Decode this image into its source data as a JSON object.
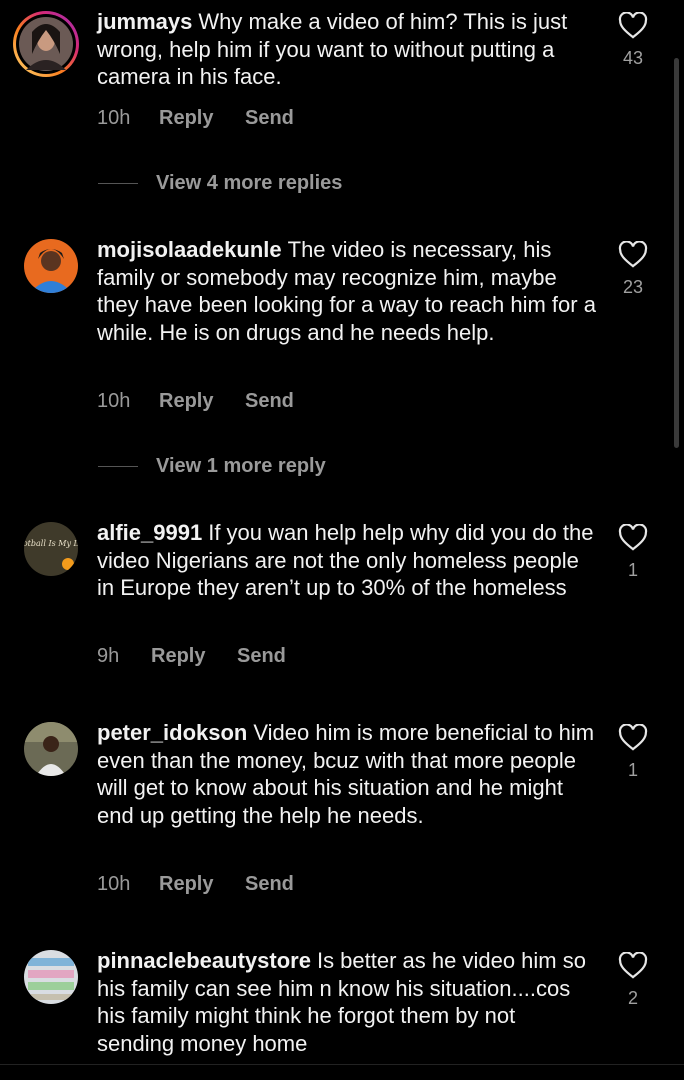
{
  "comments": [
    {
      "username": "jummays",
      "text": "Why make a video of him? This is just wrong, help him if you want to without putting a camera in his face.",
      "time": "10h",
      "reply_label": "Reply",
      "send_label": "Send",
      "likes": "43",
      "more_replies": "View 4 more replies"
    },
    {
      "username": "mojisolaadekunle",
      "text": "The video is necessary, his family or somebody may recognize him, maybe they have been looking for a way to reach him for a while.  He is on drugs and he needs help.",
      "time": "10h",
      "reply_label": "Reply",
      "send_label": "Send",
      "likes": "23",
      "more_replies": "View 1 more reply"
    },
    {
      "username": "alfie_9991",
      "text": "If you wan help help why did you do the video Nigerians are not the only homeless people in Europe they aren’t up to 30% of the homeless",
      "time": "9h",
      "reply_label": "Reply",
      "send_label": "Send",
      "likes": "1",
      "avatar_text": "Football Is My Life"
    },
    {
      "username": "peter_idokson",
      "text": "Video him is more beneficial to him even than the money, bcuz with that more people will get to know about his situation and he might end  up getting the help he needs.",
      "time": "10h",
      "reply_label": "Reply",
      "send_label": "Send",
      "likes": "1"
    },
    {
      "username": "pinnaclebeautystore",
      "text": "Is better as he video him so his family can see him n know his situation....cos his family might think he forgot them by not sending money home",
      "likes": "2"
    }
  ],
  "icons": {
    "like": "heart-outline-icon"
  },
  "colors": {
    "background": "#000000",
    "text": "#f2f2f2",
    "muted": "#9a9a9a",
    "story_ring": "#d62976"
  }
}
